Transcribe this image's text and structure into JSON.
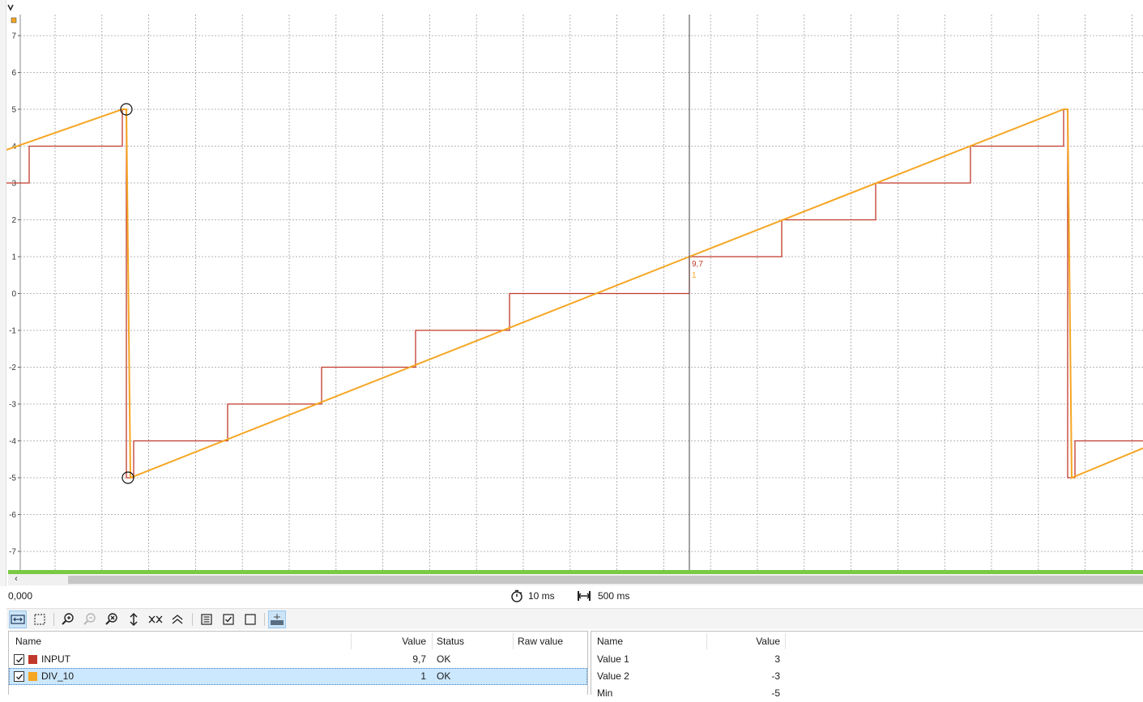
{
  "colors": {
    "series_input": "#c0392b",
    "series_div10": "#f5a623",
    "grid": "#9a9a9a",
    "timeline": "#7ac943",
    "selection": "#cce8ff"
  },
  "chart_data": {
    "type": "line",
    "ylim": [
      -7.5,
      7.5
    ],
    "xlim": [
      0,
      1403
    ],
    "y_ticks": [
      "7",
      "6",
      "5",
      "4",
      "3",
      "2",
      "1",
      "0",
      "-1",
      "-2",
      "-3",
      "-4",
      "-5",
      "-6",
      "-7"
    ],
    "grid": true,
    "cursor": {
      "labels": [
        "9,7",
        "1"
      ]
    },
    "series": [
      {
        "name": "INPUT",
        "color": "#c0392b",
        "step": true,
        "points": [
          [
            0,
            3
          ],
          [
            28,
            4
          ],
          [
            143,
            5
          ],
          [
            148,
            -5
          ],
          [
            157,
            -4
          ],
          [
            273,
            -3
          ],
          [
            389,
            -2
          ],
          [
            505,
            -1
          ],
          [
            621,
            0
          ],
          [
            843,
            1
          ],
          [
            957,
            2
          ],
          [
            1073,
            3
          ],
          [
            1190,
            4
          ],
          [
            1305,
            5
          ],
          [
            1310,
            -5
          ],
          [
            1319,
            -4
          ],
          [
            1403,
            -4
          ]
        ]
      },
      {
        "name": "DIV_10",
        "color": "#f5a623",
        "step": false,
        "points": [
          [
            0,
            3.9
          ],
          [
            143,
            5
          ],
          [
            148,
            5
          ],
          [
            153,
            -5
          ],
          [
            843,
            1
          ],
          [
            1305,
            5
          ],
          [
            1310,
            5
          ],
          [
            1315,
            -5
          ],
          [
            1403,
            -4.2
          ]
        ]
      }
    ],
    "markers": [
      [
        148,
        5
      ],
      [
        150,
        -5
      ]
    ]
  },
  "status": {
    "time_offset": "0,000",
    "sample_rate": "10 ms",
    "time_window": "500 ms"
  },
  "toolbar": {
    "icons": [
      "zoom-x-icon",
      "zoom-box-icon",
      "zoom-in-icon",
      "zoom-out-icon",
      "zoom-fit-icon",
      "fit-vertical-icon",
      "fit-horizontal-icon",
      "stretch-icon",
      "select-list-icon",
      "check-all-icon",
      "uncheck-all-icon",
      "baseline-icon"
    ]
  },
  "signals": {
    "headers": {
      "name": "Name",
      "value": "Value",
      "status": "Status",
      "raw": "Raw value"
    },
    "rows": [
      {
        "checked": true,
        "color": "#c0392b",
        "name": "INPUT",
        "value": "9,7",
        "status": "OK",
        "raw": ""
      },
      {
        "checked": true,
        "color": "#f5a623",
        "name": "DIV_10",
        "value": "1",
        "status": "OK",
        "raw": ""
      }
    ]
  },
  "properties": {
    "headers": {
      "name": "Name",
      "value": "Value"
    },
    "rows": [
      {
        "name": "Value 1",
        "value": "3"
      },
      {
        "name": "Value 2",
        "value": "-3"
      },
      {
        "name": "Min",
        "value": "-5"
      }
    ]
  }
}
